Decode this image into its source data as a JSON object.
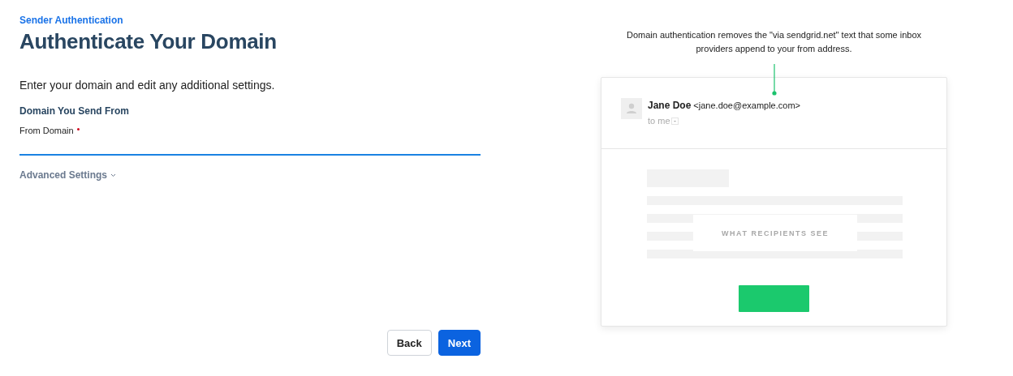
{
  "breadcrumb": "Sender Authentication",
  "title": "Authenticate Your Domain",
  "intro": "Enter your domain and edit any additional settings.",
  "section_heading": "Domain You Send From",
  "field": {
    "label": "From Domain",
    "required": true,
    "focused": true
  },
  "advanced_settings": {
    "label": "Advanced Settings",
    "expanded": false
  },
  "buttons": [
    {
      "label": "Back",
      "kind": "secondary"
    },
    {
      "label": "Next",
      "kind": "primary"
    }
  ],
  "preview": {
    "caption": "Domain authentication removes the \"via sendgrid.net\" text that some inbox providers append to your from address.",
    "sender_name": "Jane Doe",
    "sender_email": "<jane.doe@example.com>",
    "recipient": "to me",
    "overlay_label": "WHAT RECIPIENTS SEE"
  }
}
